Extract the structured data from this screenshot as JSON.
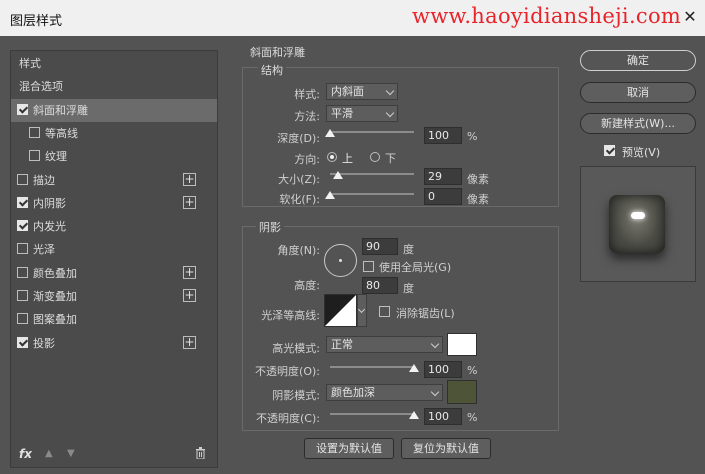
{
  "window": {
    "title": "图层样式",
    "watermark": "www.haoyidiansheji.com"
  },
  "styles_panel": {
    "items": [
      {
        "label": "样式",
        "has_checkbox": false,
        "checked": false,
        "plus": false,
        "indent": false
      },
      {
        "label": "混合选项",
        "has_checkbox": false,
        "checked": false,
        "plus": false,
        "indent": false
      },
      {
        "label": "斜面和浮雕",
        "has_checkbox": true,
        "checked": true,
        "plus": false,
        "indent": false,
        "selected": true
      },
      {
        "label": "等高线",
        "has_checkbox": true,
        "checked": false,
        "plus": false,
        "indent": true
      },
      {
        "label": "纹理",
        "has_checkbox": true,
        "checked": false,
        "plus": false,
        "indent": true
      },
      {
        "label": "描边",
        "has_checkbox": true,
        "checked": false,
        "plus": true,
        "indent": false
      },
      {
        "label": "内阴影",
        "has_checkbox": true,
        "checked": true,
        "plus": true,
        "indent": false
      },
      {
        "label": "内发光",
        "has_checkbox": true,
        "checked": true,
        "plus": false,
        "indent": false
      },
      {
        "label": "光泽",
        "has_checkbox": true,
        "checked": false,
        "plus": false,
        "indent": false
      },
      {
        "label": "颜色叠加",
        "has_checkbox": true,
        "checked": false,
        "plus": true,
        "indent": false
      },
      {
        "label": "渐变叠加",
        "has_checkbox": true,
        "checked": false,
        "plus": true,
        "indent": false
      },
      {
        "label": "图案叠加",
        "has_checkbox": true,
        "checked": false,
        "plus": false,
        "indent": false
      },
      {
        "label": "投影",
        "has_checkbox": true,
        "checked": true,
        "plus": true,
        "indent": false
      }
    ],
    "plus_glyph": "+",
    "fx_label": "fx",
    "up_glyph": "▲",
    "down_glyph": "▼"
  },
  "bevel": {
    "section_title": "斜面和浮雕",
    "structure_title": "结构",
    "style_label": "样式:",
    "style_value": "内斜面",
    "method_label": "方法:",
    "method_value": "平滑",
    "depth_label": "深度(D):",
    "depth_value": "100",
    "depth_unit": "%",
    "depth_level": 0.0,
    "direction_label": "方向:",
    "dir_up": "上",
    "dir_down": "下",
    "size_label": "大小(Z):",
    "size_value": "29",
    "size_unit": "像素",
    "size_level": 0.1,
    "soften_label": "软化(F):",
    "soften_value": "0",
    "soften_unit": "像素",
    "soften_level": 0.0
  },
  "shading": {
    "title": "阴影",
    "angle_label": "角度(N):",
    "angle_value": "90",
    "angle_unit": "度",
    "global_light_label": "使用全局光(G)",
    "altitude_label": "高度:",
    "altitude_value": "80",
    "altitude_unit": "度",
    "gloss_label": "光泽等高线:",
    "antialias_label": "消除锯齿(L)",
    "highlight_mode_label": "高光模式:",
    "highlight_mode_value": "正常",
    "highlight_color": "#ffffff",
    "highlight_opacity_label": "不透明度(O):",
    "highlight_opacity_value": "100",
    "highlight_opacity_unit": "%",
    "highlight_opacity_level": 1.0,
    "shadow_mode_label": "阴影模式:",
    "shadow_mode_value": "颜色加深",
    "shadow_color": "#4e5438",
    "shadow_opacity_label": "不透明度(C):",
    "shadow_opacity_value": "100",
    "shadow_opacity_unit": "%",
    "shadow_opacity_level": 1.0
  },
  "footer_buttons": {
    "set_default": "设置为默认值",
    "reset_default": "复位为默认值"
  },
  "right_panel": {
    "ok": "确定",
    "cancel": "取消",
    "new_style": "新建样式(W)...",
    "preview_label": "预览(V)",
    "preview_checked": true
  },
  "colors": {
    "dialog_bg": "#535353",
    "watermark": "#e8232a"
  }
}
